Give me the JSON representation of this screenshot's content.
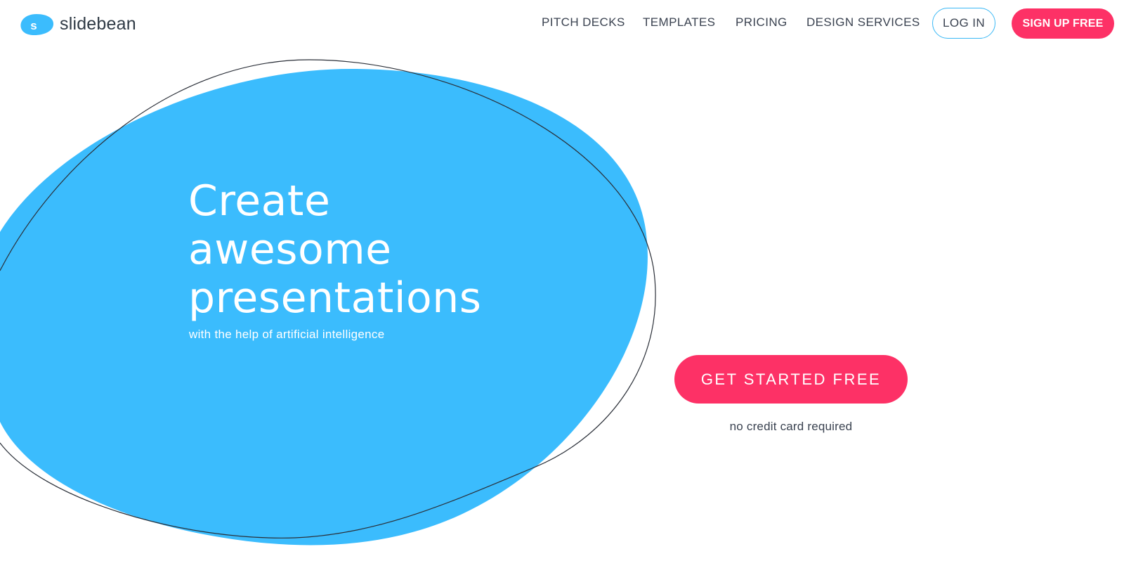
{
  "brand": {
    "name": "slidebean",
    "logo_letter": "s",
    "accent_color": "#3bbcfd",
    "cta_color": "#fd3166"
  },
  "nav": {
    "items": [
      {
        "label": "PITCH DECKS"
      },
      {
        "label": "TEMPLATES"
      },
      {
        "label": "PRICING"
      },
      {
        "label": "DESIGN SERVICES"
      }
    ],
    "login_label": "LOG IN",
    "signup_label": "SIGN UP FREE"
  },
  "hero": {
    "title_lines": [
      "Create",
      "awesome",
      "presentations"
    ],
    "subtitle": "with the help of artificial intelligence"
  },
  "cta": {
    "button_label": "GET STARTED FREE",
    "note": "no credit card required"
  }
}
